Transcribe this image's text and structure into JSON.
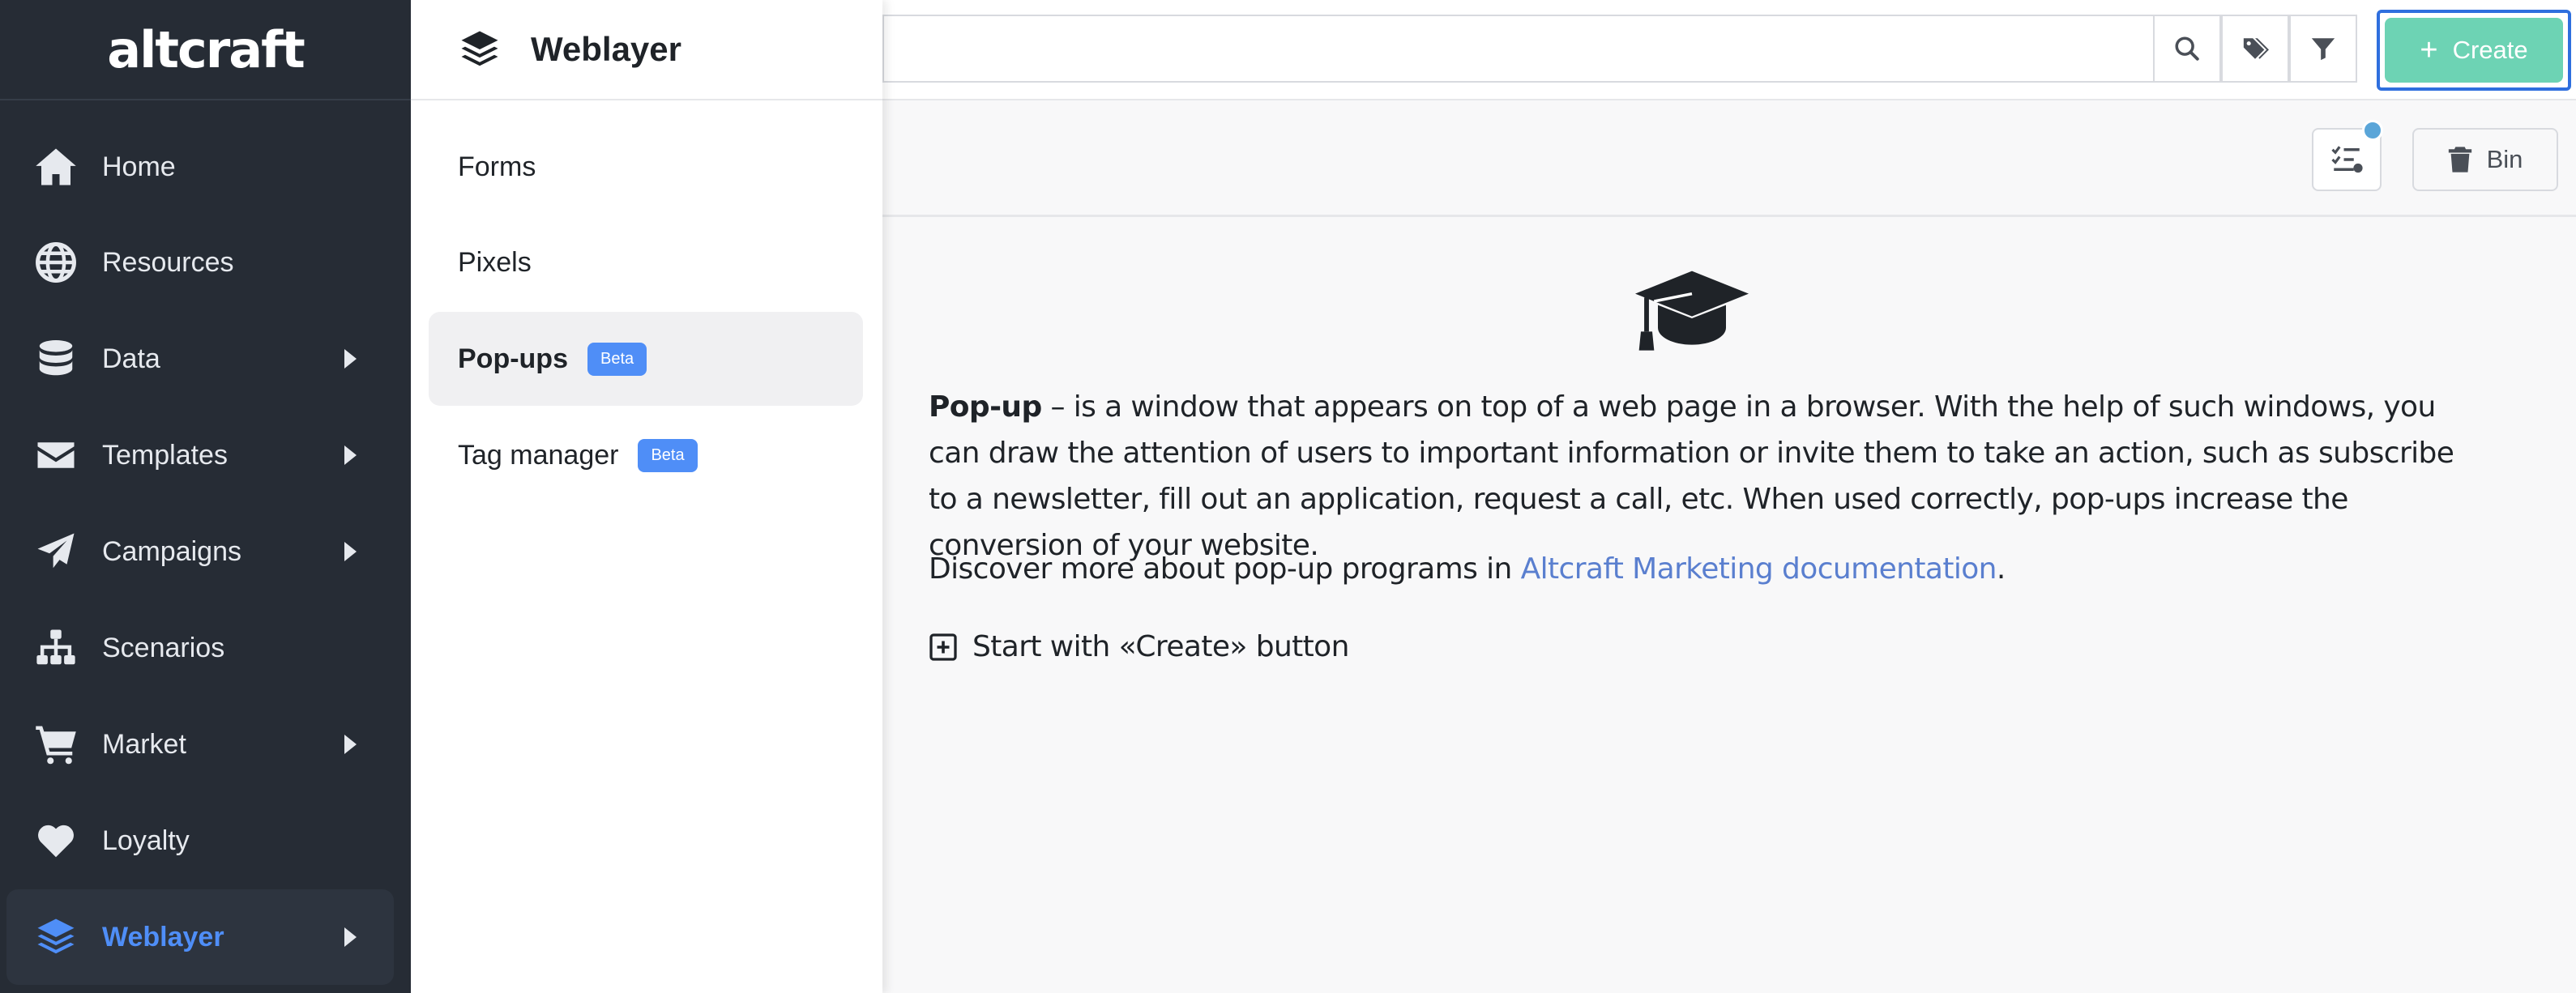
{
  "app": {
    "logo_text": "altcraft"
  },
  "sidebar": {
    "items": [
      {
        "label": "Home",
        "icon": "home-icon"
      },
      {
        "label": "Resources",
        "icon": "globe-icon"
      },
      {
        "label": "Data",
        "icon": "database-icon"
      },
      {
        "label": "Templates",
        "icon": "envelope-icon"
      },
      {
        "label": "Campaigns",
        "icon": "paper-plane-icon"
      },
      {
        "label": "Scenarios",
        "icon": "sitemap-icon"
      },
      {
        "label": "Market",
        "icon": "cart-icon"
      },
      {
        "label": "Loyalty",
        "icon": "heart-icon"
      },
      {
        "label": "Weblayer",
        "icon": "layers-icon"
      }
    ]
  },
  "submenu": {
    "title": "Weblayer",
    "items": [
      {
        "label": "Forms"
      },
      {
        "label": "Pixels"
      },
      {
        "label": "Pop-ups",
        "badge": "Beta"
      },
      {
        "label": "Tag manager",
        "badge": "Beta"
      }
    ]
  },
  "topbar": {
    "search_value": "",
    "create_label": "Create"
  },
  "toolbar": {
    "bin_label": "Bin"
  },
  "content": {
    "term": "Pop-up",
    "description": " – is a window that appears on top of a web page in a browser. With the help of such windows, you can draw the attention of users to important information or invite them to take an action, such as subscribe to a newsletter, fill out an application, request a call, etc. When used correctly, pop-ups increase the conversion of your website.",
    "more_prefix": "Discover more about pop-up programs in ",
    "more_link": "Altcraft Marketing documentation",
    "more_suffix": ".",
    "start_text": "Start with «Create» button"
  },
  "colors": {
    "sidebar_bg": "#262c35",
    "active_accent": "#4f8ef7",
    "create_button": "#6dd3b4",
    "link": "#5a7fcf",
    "beta_badge": "#4f8ef7"
  }
}
